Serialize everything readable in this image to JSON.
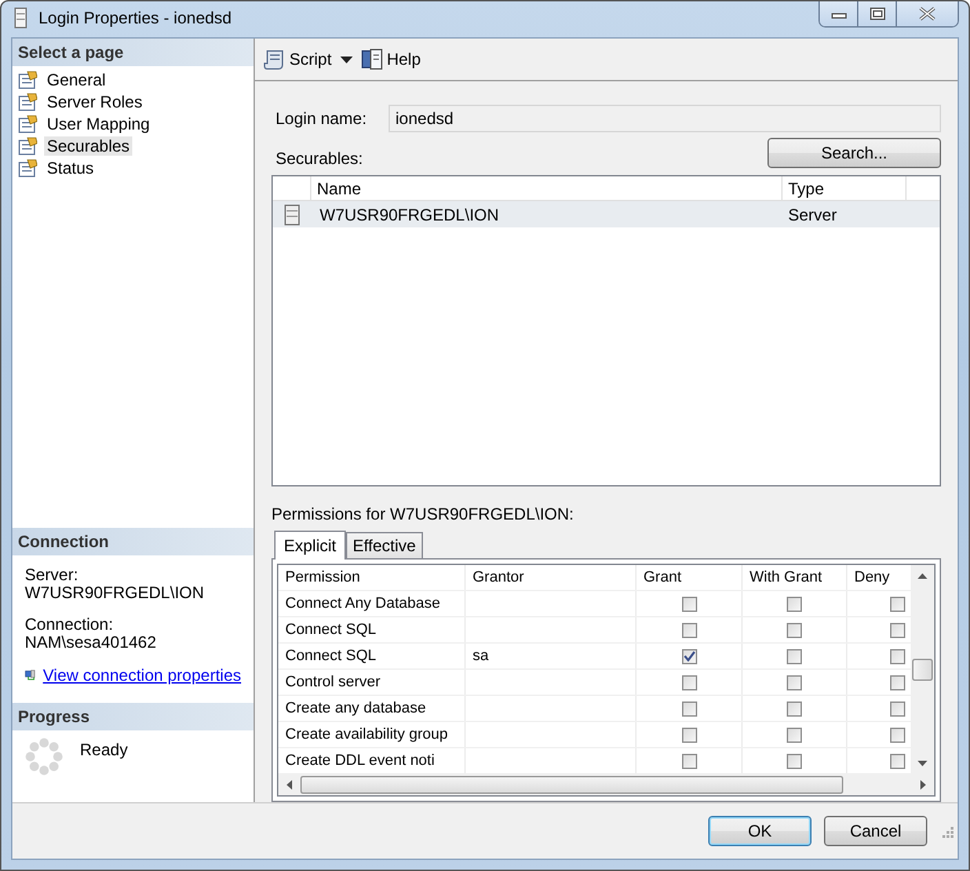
{
  "window": {
    "title": "Login Properties - ionedsd"
  },
  "sidebar": {
    "header": "Select a page",
    "items": [
      {
        "label": "General",
        "selected": false
      },
      {
        "label": "Server Roles",
        "selected": false
      },
      {
        "label": "User Mapping",
        "selected": false
      },
      {
        "label": "Securables",
        "selected": true
      },
      {
        "label": "Status",
        "selected": false
      }
    ]
  },
  "connection": {
    "header": "Connection",
    "server_label": "Server:",
    "server": "W7USR90FRGEDL\\ION",
    "connection_label": "Connection:",
    "connection": "NAM\\sesa401462",
    "link": "View connection properties"
  },
  "progress": {
    "header": "Progress",
    "status": "Ready"
  },
  "toolbar": {
    "script": "Script",
    "help": "Help"
  },
  "login_name": {
    "label": "Login name:",
    "value": "ionedsd"
  },
  "securables": {
    "label": "Securables:",
    "search_button": "Search...",
    "columns": [
      "Name",
      "Type"
    ],
    "rows": [
      {
        "name": "W7USR90FRGEDL\\ION",
        "type": "Server",
        "selected": true
      }
    ]
  },
  "permissions": {
    "label": "Permissions for W7USR90FRGEDL\\ION:",
    "tabs": [
      {
        "label": "Explicit",
        "selected": true
      },
      {
        "label": "Effective",
        "selected": false
      }
    ],
    "columns": [
      "Permission",
      "Grantor",
      "Grant",
      "With Grant",
      "Deny"
    ],
    "rows": [
      {
        "permission": "Connect Any Database",
        "grant": false,
        "with_grant": false,
        "deny": false
      },
      {
        "permission": "Connect SQL",
        "grant": false,
        "with_grant": false,
        "deny": false
      },
      {
        "permission": "Connect SQL",
        "grantor": "sa",
        "grant": true,
        "with_grant": false,
        "deny": false
      },
      {
        "permission": "Control server",
        "grant": false,
        "with_grant": false,
        "deny": false
      },
      {
        "permission": "Create any database",
        "grant": false,
        "with_grant": false,
        "deny": false
      },
      {
        "permission": "Create availability group",
        "grant": false,
        "with_grant": false,
        "deny": false
      },
      {
        "permission": "Create DDL event noti",
        "grant": false,
        "with_grant": false,
        "deny": false
      }
    ]
  },
  "buttons": [
    {
      "label": "OK",
      "default": true
    },
    {
      "label": "Cancel",
      "default": false
    }
  ]
}
